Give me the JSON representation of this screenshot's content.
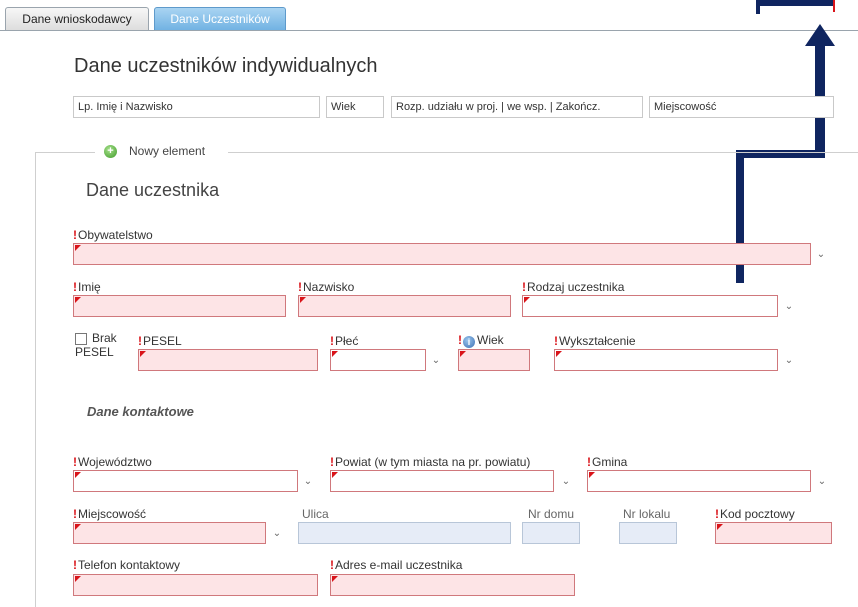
{
  "tabs": [
    {
      "label": "Dane wnioskodawcy",
      "active": false
    },
    {
      "label": "Dane Uczestników",
      "active": true
    }
  ],
  "section_title": "Dane uczestników indywidualnych",
  "columns": [
    "Lp. Imię i Nazwisko",
    "Wiek",
    "Rozp. udziału w proj. | we wsp. | Zakończ.",
    "Miejscowość"
  ],
  "new_element_label": "Nowy element",
  "participant_title": "Dane uczestnika",
  "contact_title": "Dane kontaktowe",
  "fields": {
    "citizenship": "Obywatelstwo",
    "first_name": "Imię",
    "last_name": "Nazwisko",
    "participant_type": "Rodzaj uczestnika",
    "no_pesel_line1": "Brak",
    "no_pesel_line2": "PESEL",
    "pesel": "PESEL",
    "sex": "Płeć",
    "age": "Wiek",
    "education": "Wykształcenie",
    "voivodeship": "Województwo",
    "county": "Powiat (w tym miasta na pr. powiatu)",
    "commune": "Gmina",
    "town": "Miejscowość",
    "street": "Ulica",
    "house_no": "Nr domu",
    "flat_no": "Nr lokalu",
    "postal_code": "Kod pocztowy",
    "phone": "Telefon kontaktowy",
    "email": "Adres e-mail uczestnika"
  },
  "required_marker": "!",
  "colors": {
    "required": "#d9141a",
    "input_required_bg": "#fde4e6",
    "input_required_border": "#d0787c",
    "tab_active": "#6fb1e2",
    "annotation_arrow": "#0f2560"
  },
  "icons": {
    "add": "plus-circle-icon",
    "info": "info-icon",
    "dropdown": "chevron-down-icon"
  }
}
